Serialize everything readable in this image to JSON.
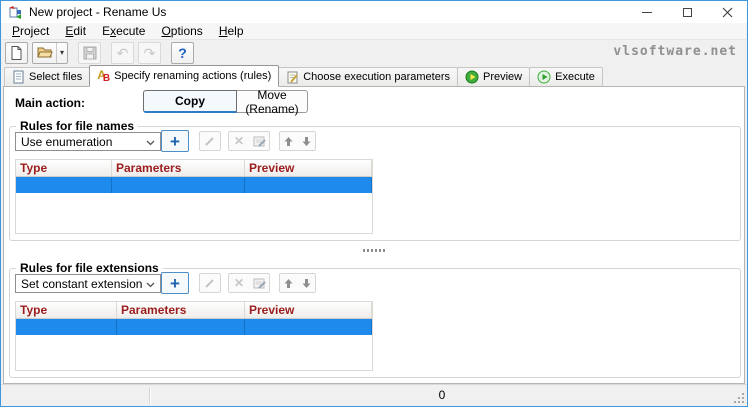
{
  "colors": {
    "window_border": "#3f97dd",
    "selection_blue": "#1e8bec",
    "table_header_text": "#9b1d1d",
    "accent_blue": "#2e7cc4",
    "brand_text": "#8f8f8f",
    "toolbar_bg": "#f0f0f0"
  },
  "icons": {
    "app-icon": "rename-us-logo",
    "minimize-icon": "horizontal-line",
    "maximize-icon": "square-outline",
    "close-icon": "x-cross",
    "new-file-icon": "blank-page",
    "open-folder-icon": "folder",
    "open-dropdown-arrow-icon": "▾",
    "save-icon": "floppy-disk",
    "undo-icon": "↶",
    "redo-icon": "↷",
    "help-icon": "?",
    "document-icon": "document-outline",
    "rename-ab-a": "A",
    "rename-ab-b": "B",
    "note-edit-icon": "note-with-pencil",
    "preview-play-icon": "green-circle-yellow-play",
    "execute-play-icon": "light-circle-green-play",
    "combo-chevron-icon": "chevron-down",
    "add-rule-icon": "+",
    "edit-rule-icon": "pencil-stroke",
    "delete-rule-icon": "✕",
    "edit-form-icon": "form-with-pencil",
    "move-up-icon": "solid-up-arrow",
    "move-down-icon": "solid-down-arrow",
    "splitter-grip-icon": "dotted-grip",
    "resize-grip-icon": "diagonal-dots"
  },
  "titlebar": {
    "title": "New project - Rename Us"
  },
  "menubar": {
    "items": [
      {
        "label": "Project",
        "accel": 0
      },
      {
        "label": "Edit",
        "accel": 0
      },
      {
        "label": "Execute",
        "accel": 1
      },
      {
        "label": "Options",
        "accel": 0
      },
      {
        "label": "Help",
        "accel": 0
      }
    ]
  },
  "toolbar": {
    "brand": "vlsoftware.net"
  },
  "tabs": [
    {
      "label": "Select files",
      "icon": "document-icon",
      "active": false
    },
    {
      "label": "Specify renaming actions (rules)",
      "icon": "rename-ab-icon",
      "active": true
    },
    {
      "label": "Choose execution parameters",
      "icon": "note-edit-icon",
      "active": false
    },
    {
      "label": "Preview",
      "icon": "preview-play-icon",
      "active": false
    },
    {
      "label": "Execute",
      "icon": "execute-play-icon",
      "active": false
    }
  ],
  "main": {
    "action_label": "Main action:",
    "copy_label": "Copy",
    "move_label": "Move (Rename)",
    "selected_action": "Copy",
    "groups": [
      {
        "title": "Rules for file names",
        "dropdown_value": "Use enumeration",
        "columns": [
          "Type",
          "Parameters",
          "Preview"
        ],
        "rows": [
          {
            "type": "",
            "parameters": "",
            "preview": "",
            "selected": true
          }
        ]
      },
      {
        "title": "Rules for file extensions",
        "dropdown_value": "Set constant extension",
        "columns": [
          "Type",
          "Parameters",
          "Preview"
        ],
        "rows": [
          {
            "type": "",
            "parameters": "",
            "preview": "",
            "selected": true
          }
        ]
      }
    ]
  },
  "statusbar": {
    "count": "0"
  }
}
